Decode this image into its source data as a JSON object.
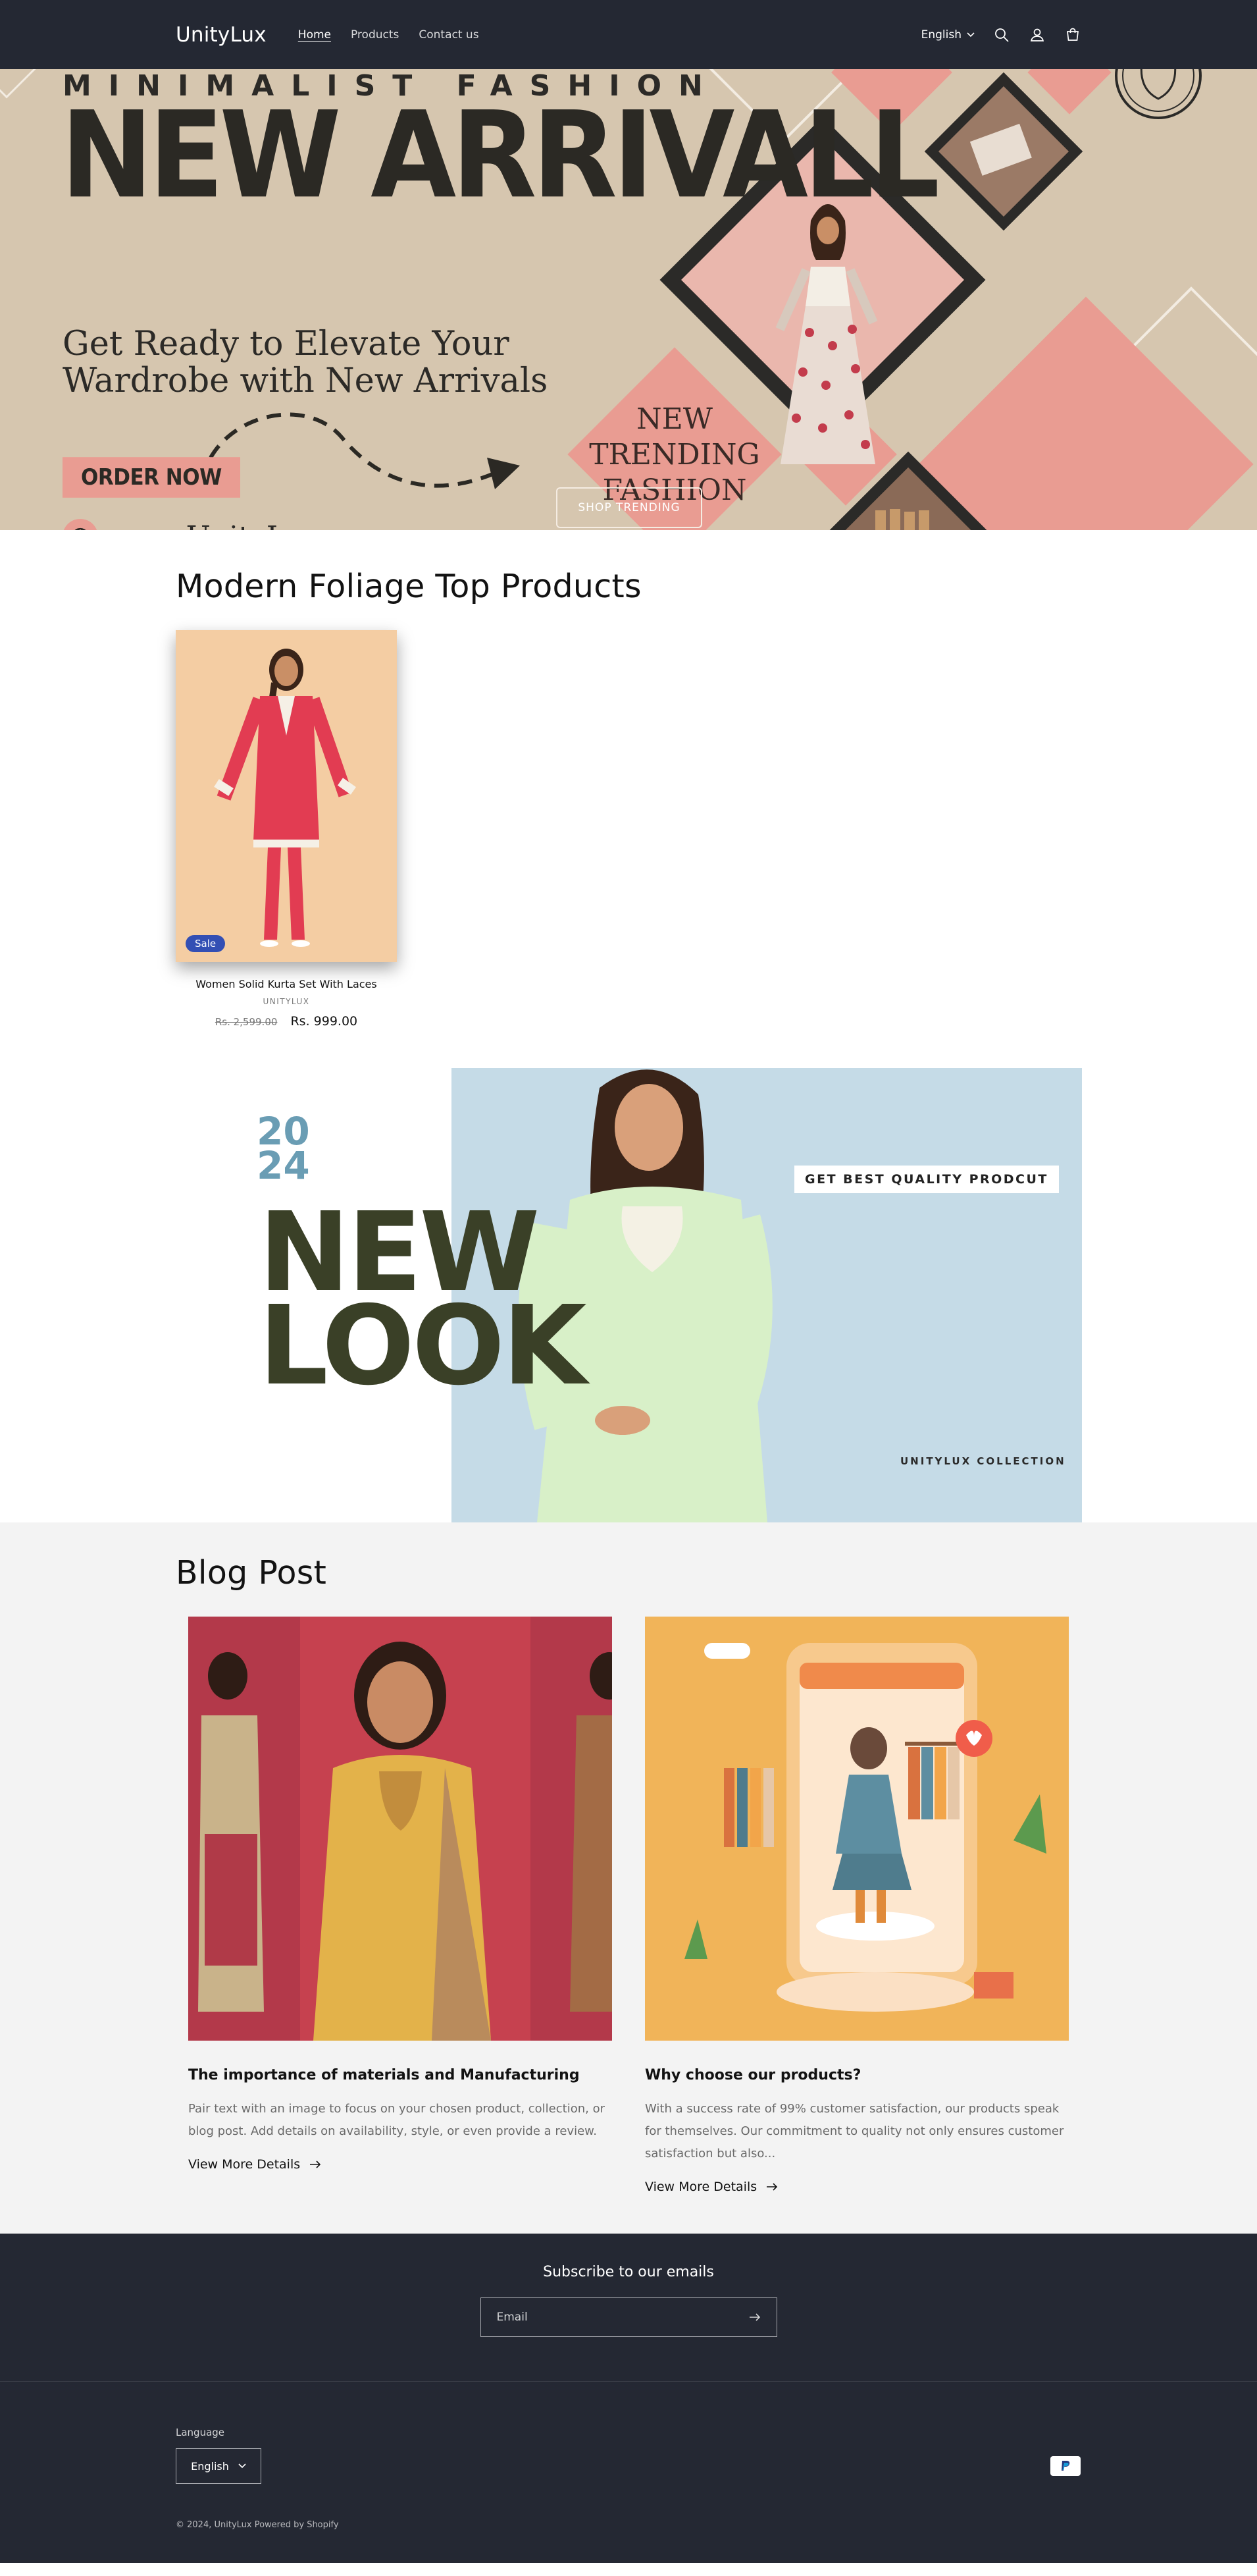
{
  "header": {
    "logo": "UnityLux",
    "nav": [
      {
        "label": "Home",
        "active": true
      },
      {
        "label": "Products",
        "active": false
      },
      {
        "label": "Contact us",
        "active": false
      }
    ],
    "language": "English",
    "icons": [
      "search-icon",
      "account-icon",
      "cart-icon"
    ]
  },
  "hero": {
    "tagline": "MINIMALIST FASHION",
    "title": "NEW ARRIVALL",
    "subtitle": "Get Ready to Elevate Your Wardrobe with New Arrivals",
    "order_button": "ORDER NOW",
    "url": "www.UnityLux.com",
    "trending_text": "NEW TRENDING FASHION",
    "shop_button": "SHOP TRENDING",
    "colors": {
      "background": "#d6c6af",
      "accent": "#e99c92",
      "dark": "#2b2924"
    }
  },
  "products": {
    "title": "Modern Foliage Top Products",
    "items": [
      {
        "name": "Women Solid Kurta Set With Laces",
        "vendor": "UNITYLUX",
        "old_price": "Rs. 2,599.00",
        "price": "Rs. 999.00",
        "badge": "Sale"
      }
    ]
  },
  "banner": {
    "year_top": "20",
    "year_bottom": "24",
    "line1": "NEW",
    "line2": "LOOK",
    "tag": "GET BEST QUALITY PRODCUT",
    "collection": "UNITYLUX COLLECTION"
  },
  "blog": {
    "title": "Blog Post",
    "posts": [
      {
        "title": "The importance of materials and Manufacturing",
        "excerpt": "Pair text with an image to focus on your chosen product, collection, or blog post. Add details on availability, style, or even provide a review.",
        "link": "View More Details"
      },
      {
        "title": "Why choose our products?",
        "excerpt": "With a success rate of 99% customer satisfaction, our products speak for themselves. Our commitment to quality not only ensures customer satisfaction but also...",
        "link": "View More Details"
      }
    ]
  },
  "newsletter": {
    "heading": "Subscribe to our emails",
    "email_placeholder": "Email"
  },
  "footer": {
    "language_label": "Language",
    "language_value": "English",
    "copyright": "© 2024, UnityLux Powered by Shopify",
    "payment_icon": "paypal-icon"
  }
}
